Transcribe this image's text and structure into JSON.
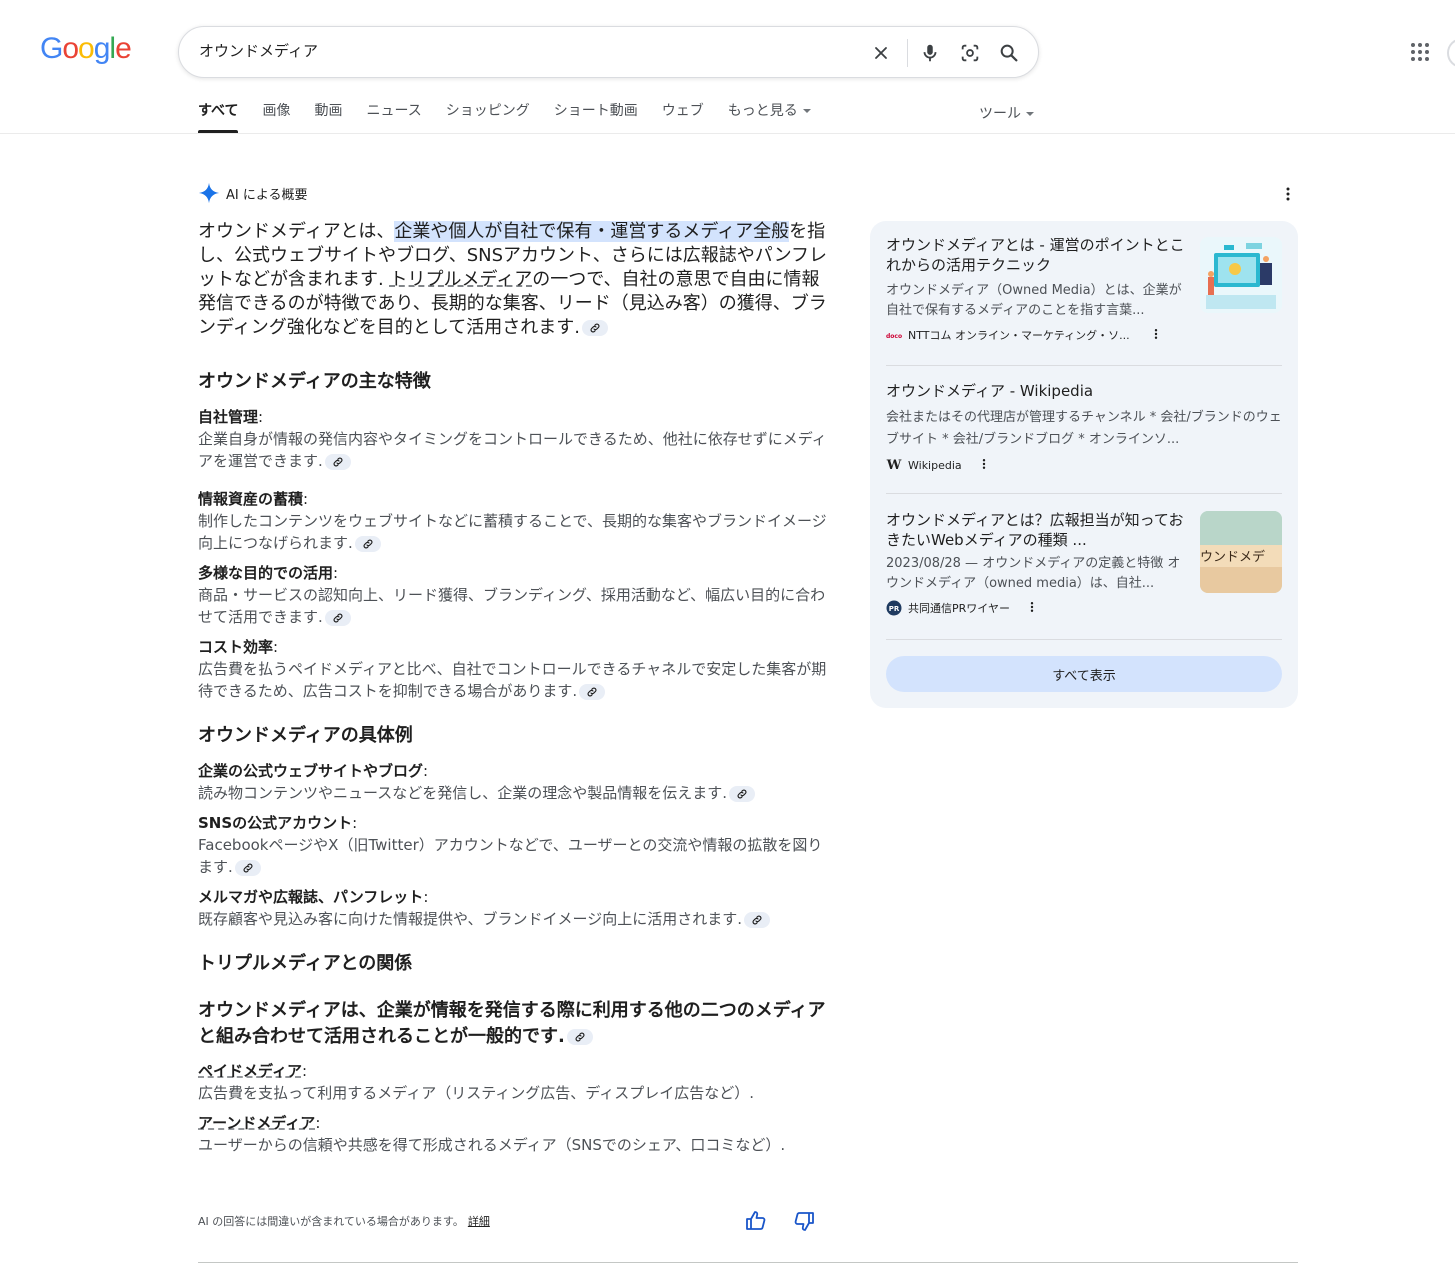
{
  "header": {
    "logo_letters": [
      "G",
      "o",
      "o",
      "g",
      "l",
      "e"
    ],
    "logo_colors": [
      "#4285F4",
      "#EA4335",
      "#FBBC05",
      "#4285F4",
      "#34A853",
      "#EA4335"
    ],
    "query": "オウンドメディア"
  },
  "tabs": [
    {
      "label": "すべて",
      "active": true
    },
    {
      "label": "画像"
    },
    {
      "label": "動画"
    },
    {
      "label": "ニュース"
    },
    {
      "label": "ショッピング"
    },
    {
      "label": "ショート動画"
    },
    {
      "label": "ウェブ"
    },
    {
      "label": "もっと見る"
    }
  ],
  "tools_label": "ツール",
  "ai": {
    "label": "AI による概要",
    "lead": {
      "p1": "オウンドメディアとは、",
      "highlight": "企業や個人が自社で保有・運営するメディア全般",
      "p2": "を指し、公式ウェブサイトやブログ、SNSアカウント、さらには広報誌やパンフレットなどが含まれます. ",
      "link": "トリプルメディア",
      "p3": "の一つで、自社の意思で自由に情報発信できるのが特徴であり、長期的な集客、リード（見込み客）の獲得、ブランディング強化などを目的として活用されます."
    },
    "features": {
      "heading": "オウンドメディアの主な特徴",
      "items": [
        {
          "title": "自社管理",
          "desc": "企業自身が情報の発信内容やタイミングをコントロールできるため、他社に依存せずにメディアを運営できます."
        },
        {
          "title": "情報資産の蓄積",
          "desc": "制作したコンテンツをウェブサイトなどに蓄積することで、長期的な集客やブランドイメージ向上につなげられます."
        },
        {
          "title": "多様な目的での活用",
          "desc": "商品・サービスの認知向上、リード獲得、ブランディング、採用活動など、幅広い目的に合わせて活用できます."
        },
        {
          "title": "コスト効率",
          "desc": "広告費を払うペイドメディアと比べ、自社でコントロールできるチャネルで安定した集客が期待できるため、広告コストを抑制できる場合があります."
        }
      ]
    },
    "examples": {
      "heading": "オウンドメディアの具体例",
      "items": [
        {
          "title": "企業の公式ウェブサイトやブログ",
          "desc": "読み物コンテンツやニュースなどを発信し、企業の理念や製品情報を伝えます."
        },
        {
          "title": "SNSの公式アカウント",
          "desc": "FacebookページやX（旧Twitter）アカウントなどで、ユーザーとの交流や情報の拡散を図ります."
        },
        {
          "title": "メルマガや広報誌、パンフレット",
          "desc": "既存顧客や見込み客に向けた情報提供や、ブランドイメージ向上に活用されます."
        }
      ]
    },
    "triple": {
      "heading": "トリプルメディアとの関係",
      "paragraph": "オウンドメディアは、企業が情報を発信する際に利用する他の二つのメディアと組み合わせて活用されることが一般的です.",
      "items": [
        {
          "title": "ペイドメディア",
          "desc": "広告費を支払って利用するメディア（リスティング広告、ディスプレイ広告など）."
        },
        {
          "title": "アーンドメディア",
          "desc": "ユーザーからの信頼や共感を得て形成されるメディア（SNSでのシェア、口コミなど）."
        }
      ]
    },
    "disclaimer": "AI の回答には間違いが含まれている場合があります。",
    "disclaimer_link": "詳細"
  },
  "sources": {
    "items": [
      {
        "title": "オウンドメディアとは - 運営のポイントとこれからの活用テクニック",
        "snippet": "オウンドメディア（Owned Media）とは、企業が自社で保有するメディアのことを指す言葉...",
        "site": "NTTコム オンライン・マーケティング・ソ...",
        "favicon_text": "docomo"
      },
      {
        "title": "オウンドメディア - Wikipedia",
        "snippet": "会社またはその代理店が管理するチャンネル * 会社/ブランドのウェブサイト * 会社/ブランドブログ * オンラインソ...",
        "site": "Wikipedia",
        "favicon_text": "W"
      },
      {
        "title": "オウンドメディアとは？広報担当が知っておきたいWebメディアの種類 ...",
        "snippet": "2023/08/28 — オウンドメディアの定義と特徴 オウンドメディア（owned media）は、自社...",
        "site": "共同通信PRワイヤー",
        "favicon_text": "PR",
        "thumb_text": "ウンドメデ"
      }
    ],
    "show_all": "すべて表示"
  },
  "colors": {
    "accent": "#1a73e8",
    "panel_bg": "#f0f4f9",
    "button_bg": "#d3e3fd"
  }
}
